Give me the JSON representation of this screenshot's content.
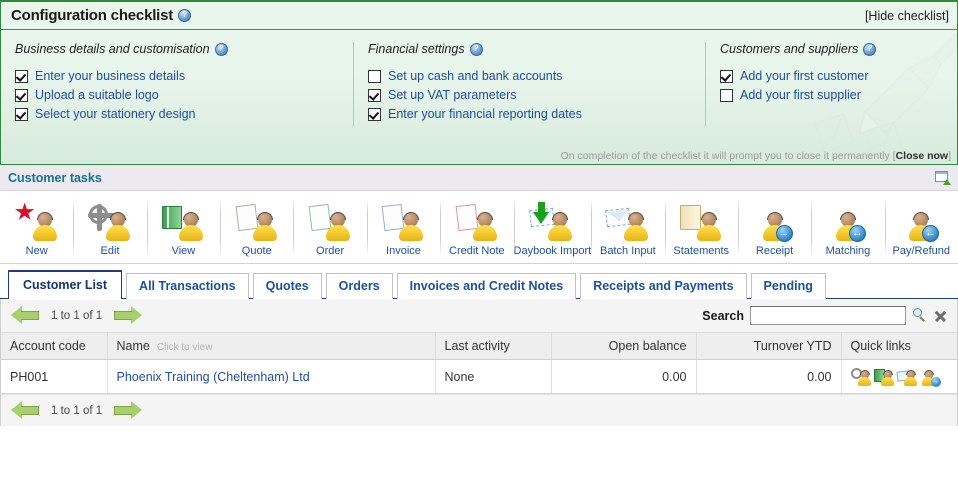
{
  "checklist": {
    "title": "Configuration checklist",
    "hide_link": "[Hide checklist]",
    "footer_text": "On completion of the checklist it will prompt you to close it permanently [",
    "footer_link": "Close now",
    "footer_end": "]",
    "columns": [
      {
        "heading": "Business details and customisation",
        "items": [
          {
            "label": "Enter your business details",
            "checked": true
          },
          {
            "label": "Upload a suitable logo",
            "checked": true
          },
          {
            "label": "Select your stationery design",
            "checked": true
          }
        ]
      },
      {
        "heading": "Financial settings",
        "items": [
          {
            "label": "Set up cash and bank accounts",
            "checked": false
          },
          {
            "label": "Set up VAT parameters",
            "checked": true
          },
          {
            "label": "Enter your financial reporting dates",
            "checked": true
          }
        ]
      },
      {
        "heading": "Customers and suppliers",
        "items": [
          {
            "label": "Add your first customer",
            "checked": true
          },
          {
            "label": "Add your first supplier",
            "checked": false
          }
        ]
      }
    ]
  },
  "tasks": {
    "title": "Customer tasks",
    "restore_icon": "window-restore-icon",
    "items": [
      {
        "label": "New",
        "icon": "new-customer-icon"
      },
      {
        "label": "Edit",
        "icon": "edit-customer-icon"
      },
      {
        "label": "View",
        "icon": "view-customer-icon"
      },
      {
        "label": "Quote",
        "icon": "quote-icon"
      },
      {
        "label": "Order",
        "icon": "order-icon"
      },
      {
        "label": "Invoice",
        "icon": "invoice-icon"
      },
      {
        "label": "Credit Note",
        "icon": "credit-note-icon"
      },
      {
        "label": "Daybook Import",
        "icon": "daybook-import-icon"
      },
      {
        "label": "Batch Input",
        "icon": "batch-input-icon"
      },
      {
        "label": "Statements",
        "icon": "statements-icon"
      },
      {
        "label": "Receipt",
        "icon": "receipt-icon"
      },
      {
        "label": "Matching",
        "icon": "matching-icon"
      },
      {
        "label": "Pay/Refund",
        "icon": "pay-refund-icon"
      }
    ]
  },
  "tabs": [
    {
      "label": "Customer List",
      "active": true
    },
    {
      "label": "All Transactions",
      "active": false
    },
    {
      "label": "Quotes",
      "active": false
    },
    {
      "label": "Orders",
      "active": false
    },
    {
      "label": "Invoices and Credit Notes",
      "active": false
    },
    {
      "label": "Receipts and Payments",
      "active": false
    },
    {
      "label": "Pending",
      "active": false
    }
  ],
  "pager": {
    "range_top": "1 to 1 of 1",
    "range_bottom": "1 to 1 of 1",
    "prev_icon": "arrow-left-icon",
    "next_icon": "arrow-right-icon"
  },
  "search": {
    "label": "Search",
    "value": "",
    "placeholder": "",
    "search_icon": "magnifier-icon",
    "clear_icon": "close-icon"
  },
  "grid": {
    "headers": [
      "Account code",
      "Name",
      "Last activity",
      "Open balance",
      "Turnover YTD",
      "Quick links"
    ],
    "name_hint": "Click to view",
    "rows": [
      {
        "account_code": "PH001",
        "name": "Phoenix Training (Cheltenham) Ltd",
        "last_activity": "None",
        "open_balance": "0.00",
        "turnover_ytd": "0.00",
        "quick_links": [
          "edit-customer-icon",
          "view-customer-icon",
          "invoice-icon",
          "receipt-icon"
        ]
      }
    ]
  },
  "colors": {
    "checklist_border": "#2e8b3d",
    "checklist_bg": "#e9f6ec",
    "link_blue": "#1f4f9c",
    "tasks_header_text": "#15748f",
    "tasks_header_bg": "#eceaee",
    "tab_active_border": "#1f3f73",
    "grid_header_bg": "#eeeeee",
    "pager_bg": "#f4f4f4",
    "arrow_green": "#a7cf6b"
  }
}
